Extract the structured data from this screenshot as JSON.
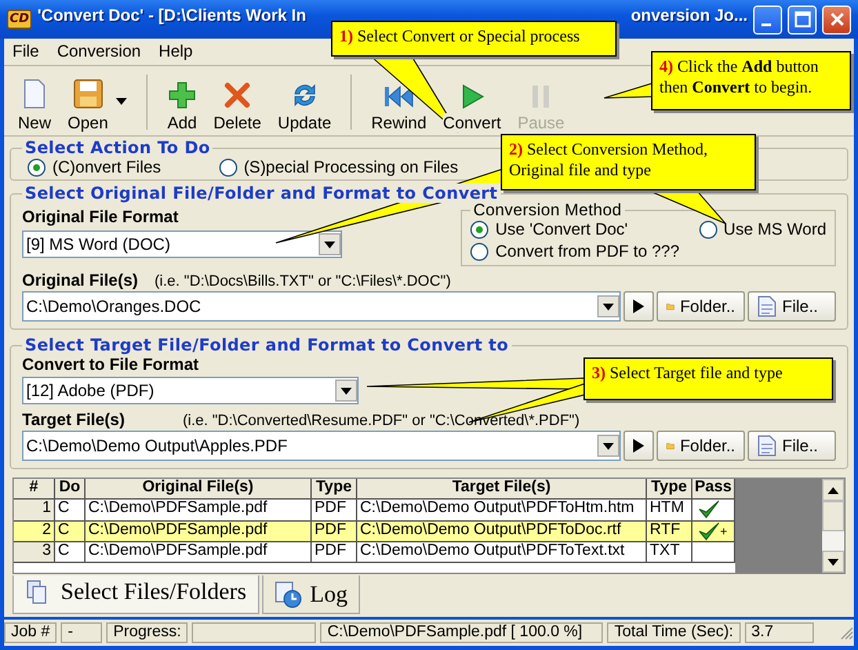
{
  "window": {
    "icon_text": "CD",
    "title_start": "'Convert Doc' - [D:\\Clients Work In",
    "title_end": "onversion Jo..."
  },
  "menu": [
    {
      "label": "File"
    },
    {
      "label": "Conversion"
    },
    {
      "label": "Help"
    }
  ],
  "toolbar": [
    {
      "label": "New",
      "kind": "new",
      "disabled": false
    },
    {
      "label": "Open",
      "kind": "open",
      "disabled": false
    },
    {
      "label": "Add",
      "kind": "add",
      "disabled": false
    },
    {
      "label": "Delete",
      "kind": "delete",
      "disabled": false
    },
    {
      "label": "Update",
      "kind": "update",
      "disabled": false
    },
    {
      "label": "Rewind",
      "kind": "rewind",
      "disabled": false
    },
    {
      "label": "Convert",
      "kind": "convert",
      "disabled": false
    },
    {
      "label": "Pause",
      "kind": "pause",
      "disabled": true
    }
  ],
  "action_group": {
    "title": "Select Action To Do",
    "options": [
      {
        "label": "(C)onvert Files",
        "selected": true
      },
      {
        "label": "(S)pecial Processing on Files",
        "selected": false
      }
    ]
  },
  "original_group": {
    "title": "Select Original File/Folder and Format to Convert",
    "format_label": "Original File Format",
    "format_value": "[9] MS Word (DOC)",
    "files_label": "Original File(s)",
    "files_hint": "(i.e. \"D:\\Docs\\Bills.TXT\"  or \"C:\\Files\\*.DOC\")",
    "files_value": "C:\\Demo\\Oranges.DOC",
    "folder_button": "Folder..",
    "file_button": "File..",
    "method": {
      "title": "Conversion Method",
      "options": [
        {
          "label": "Use 'Convert Doc'",
          "selected": true
        },
        {
          "label": "Use MS Word",
          "selected": false
        },
        {
          "label": "Convert from PDF to ???",
          "selected": false
        }
      ]
    }
  },
  "target_group": {
    "title": "Select Target File/Folder and Format to Convert to",
    "format_label": "Convert to File Format",
    "format_value": "[12] Adobe (PDF)",
    "files_label": "Target File(s)",
    "files_hint": "(i.e. \"D:\\Converted\\Resume.PDF\" or \"C:\\Converted\\*.PDF\")",
    "files_value": "C:\\Demo\\Demo Output\\Apples.PDF",
    "folder_button": "Folder..",
    "file_button": "File.."
  },
  "table": {
    "columns": [
      "#",
      "Do",
      "Original File(s)",
      "Type",
      "Target File(s)",
      "Type",
      "Pass"
    ],
    "rows": [
      {
        "cells": [
          "1",
          "C",
          "C:\\Demo\\PDFSample.pdf",
          "PDF",
          "C:\\Demo\\Demo Output\\PDFToHtm.htm",
          "HTM"
        ],
        "passed": true,
        "selected": false
      },
      {
        "cells": [
          "2",
          "C",
          "C:\\Demo\\PDFSample.pdf",
          "PDF",
          "C:\\Demo\\Demo Output\\PDFToDoc.rtf",
          "RTF"
        ],
        "passed": true,
        "pass_note": "+",
        "selected": true
      },
      {
        "cells": [
          "3",
          "C",
          "C:\\Demo\\PDFSample.pdf",
          "PDF",
          "C:\\Demo\\Demo Output\\PDFToText.txt",
          "TXT"
        ],
        "passed": false,
        "selected": false
      }
    ]
  },
  "tabs": [
    {
      "label": "Select Files/Folders",
      "selected": true
    },
    {
      "label": "Log",
      "selected": false
    }
  ],
  "status_bar": {
    "job_label": "Job #",
    "job_value": "-",
    "progress_label": "Progress:",
    "progress": {
      "level": 0
    },
    "file": "C:\\Demo\\PDFSample.pdf [ 100.0 %]",
    "time_label": "Total Time (Sec):",
    "time_value": "3.7"
  },
  "callouts": [
    {
      "number": "1)",
      "text": "Select Convert or Special process"
    },
    {
      "number": "4)",
      "text": "Click the **Add** button then **Convert** to begin."
    },
    {
      "number": "2)",
      "text": "Select Conversion Method, Original file and type"
    },
    {
      "number": "3)",
      "text": "Select Target file and type"
    }
  ]
}
